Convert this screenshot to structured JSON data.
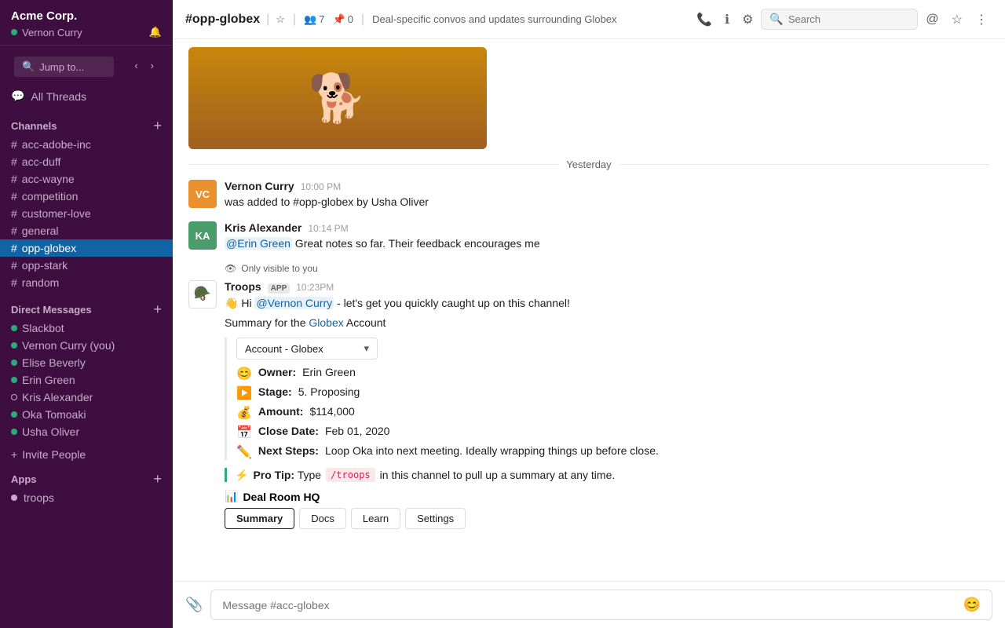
{
  "workspace": {
    "name": "Acme Corp.",
    "user": "Vernon Curry",
    "user_status": "online"
  },
  "sidebar": {
    "jump_to_label": "Jump to...",
    "all_threads_label": "All Threads",
    "channels_label": "Channels",
    "channels": [
      {
        "name": "acc-adobe-inc",
        "active": false
      },
      {
        "name": "acc-duff",
        "active": false
      },
      {
        "name": "acc-wayne",
        "active": false
      },
      {
        "name": "competition",
        "active": false
      },
      {
        "name": "customer-love",
        "active": false
      },
      {
        "name": "general",
        "active": false
      },
      {
        "name": "opp-globex",
        "active": true
      },
      {
        "name": "opp-stark",
        "active": false
      },
      {
        "name": "random",
        "active": false
      }
    ],
    "dm_label": "Direct Messages",
    "dms": [
      {
        "name": "Slackbot",
        "status": "online"
      },
      {
        "name": "Vernon Curry (you)",
        "status": "online"
      },
      {
        "name": "Elise Beverly",
        "status": "online"
      },
      {
        "name": "Erin Green",
        "status": "online"
      },
      {
        "name": "Kris Alexander",
        "status": "offline"
      },
      {
        "name": "Oka Tomoaki",
        "status": "online"
      },
      {
        "name": "Usha Oliver",
        "status": "online"
      }
    ],
    "invite_people_label": "Invite People",
    "apps_label": "Apps",
    "apps": [
      {
        "name": "troops"
      }
    ]
  },
  "topbar": {
    "channel_name": "#opp-globex",
    "star_icon": "★",
    "members_count": "7",
    "pins_count": "0",
    "description": "Deal-specific convos and updates surrounding Globex",
    "search_placeholder": "Search",
    "icons": {
      "phone": "📞",
      "info": "ℹ",
      "settings": "⚙",
      "at": "@",
      "star": "☆",
      "more": "⋮"
    }
  },
  "messages": {
    "yesterday_label": "Yesterday",
    "items": [
      {
        "id": "msg1",
        "author": "Vernon Curry",
        "time": "10:00 PM",
        "text": "was added to #opp-globex by Usha Oliver",
        "avatar_initials": "VC",
        "avatar_class": "avatar-vc"
      },
      {
        "id": "msg2",
        "author": "Kris Alexander",
        "time": "10:14 PM",
        "text_html": "@Erin Green Great notes so far.  Their feedback encourages me",
        "avatar_initials": "KA",
        "avatar_class": "avatar-ka"
      },
      {
        "id": "msg3",
        "author": "Troops",
        "app_badge": "APP",
        "time": "10:23PM",
        "only_visible": "Only visible to you",
        "avatar_class": "avatar-troops",
        "greeting": "👋 Hi",
        "mention_vernon": "@Vernon Curry",
        "intro": " - let's get you quickly caught up on this channel!",
        "summary_prefix": "Summary for the ",
        "summary_link": "Globex",
        "summary_suffix": " Account",
        "account_dropdown": "Account - Globex",
        "card": {
          "owner": {
            "emoji": "😊",
            "label": "Owner:",
            "value": "Erin Green"
          },
          "stage": {
            "emoji": "▶",
            "label": "Stage:",
            "value": "5. Proposing"
          },
          "amount": {
            "emoji": "💰",
            "label": "Amount:",
            "value": "$114,000"
          },
          "close_date": {
            "emoji": "📅",
            "label": "Close Date:",
            "value": "Feb 01, 2020"
          },
          "next_steps": {
            "emoji": "✏",
            "label": "Next Steps:",
            "value": "Loop Oka into next meeting.  Ideally wrapping things up before close."
          }
        },
        "pro_tip_icon": "⚡",
        "pro_tip_text": "Pro Tip: Type",
        "pro_tip_code": "/troops",
        "pro_tip_suffix": "in this channel to pull up a summary at any time.",
        "deal_room_icon": "📊",
        "deal_room_label": "Deal Room HQ",
        "tabs": [
          "Summary",
          "Docs",
          "Learn",
          "Settings"
        ]
      }
    ]
  },
  "message_input": {
    "placeholder": "Message #acc-globex"
  }
}
